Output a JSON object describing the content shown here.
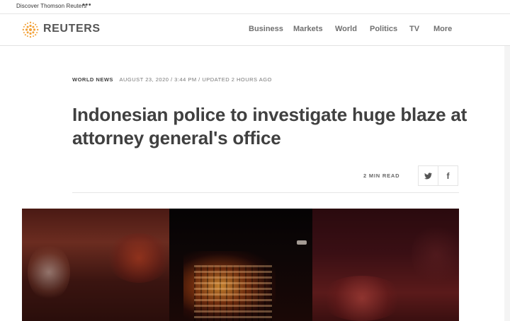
{
  "topbar": {
    "discover_label": "Discover Thomson Reuters",
    "more_dots": "•••"
  },
  "header": {
    "brand": "REUTERS",
    "nav": [
      "Business",
      "Markets",
      "World",
      "Politics",
      "TV",
      "More"
    ]
  },
  "article": {
    "section": "WORLD NEWS",
    "dateline": "AUGUST 23, 2020 / 3:44 PM / UPDATED 2 HOURS AGO",
    "headline": "Indonesian police to investigate huge blaze at attorney general's office",
    "read_time": "2 MIN READ",
    "share": {
      "twitter_icon": "twitter-icon",
      "facebook_icon": "facebook-icon",
      "facebook_glyph": "f"
    }
  },
  "colors": {
    "text_dark": "#404040",
    "nav_text": "#707070",
    "logo_orange": "#f2a23a"
  }
}
